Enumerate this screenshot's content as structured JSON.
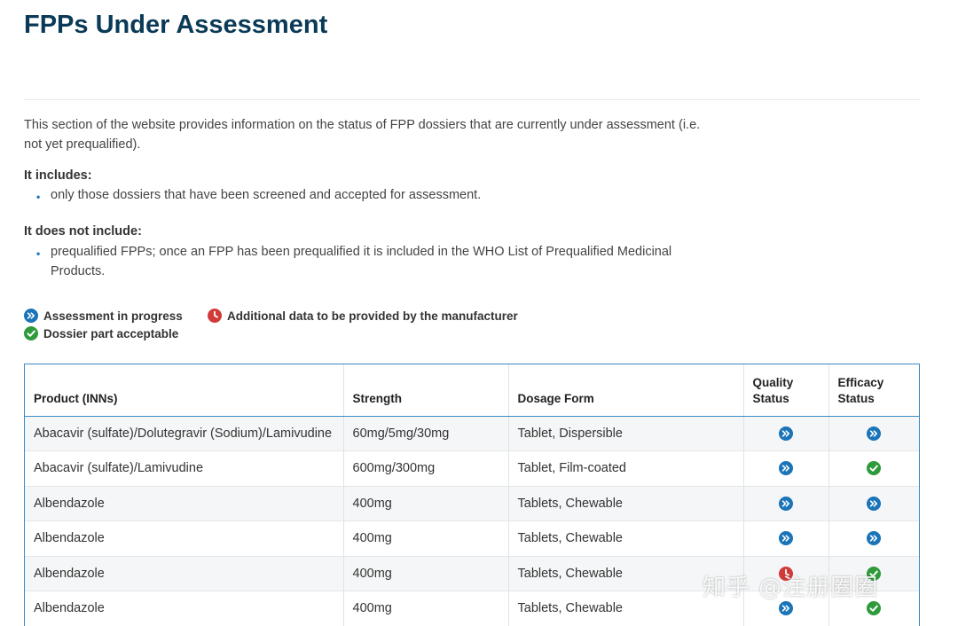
{
  "page": {
    "title": "FPPs Under Assessment",
    "intro": "This section of the website provides information on the status of FPP dossiers that are currently under assessment (i.e. not yet prequalified).",
    "includes_heading": "It includes:",
    "includes_items": [
      "only those dossiers that have been screened and accepted for assessment."
    ],
    "excludes_heading": "It does not include:",
    "excludes_items": [
      "prequalified FPPs; once an FPP has been prequalified it is included in the WHO List of Prequalified Medicinal Products."
    ]
  },
  "legend": {
    "in_progress": "Assessment in progress",
    "additional_data": "Additional data to be provided by the manufacturer",
    "acceptable": "Dossier part acceptable"
  },
  "colors": {
    "title": "#0a3a57",
    "in_progress": "#1a74b8",
    "acceptable": "#2e9a3a",
    "additional_data": "#d23a3a",
    "table_border": "#3b8bc4"
  },
  "icons": {
    "in_progress": "double-chevron-right-icon",
    "acceptable": "checkmark-icon",
    "additional_data": "clock-icon"
  },
  "table": {
    "headers": {
      "product": "Product (INNs)",
      "strength": "Strength",
      "dosage_form": "Dosage Form",
      "quality": "Quality Status",
      "efficacy": "Efficacy Status"
    },
    "rows": [
      {
        "product": "Abacavir (sulfate)/Dolutegravir (Sodium)/Lamivudine",
        "strength": "60mg/5mg/30mg",
        "dosage_form": "Tablet, Dispersible",
        "quality": "in_progress",
        "efficacy": "in_progress"
      },
      {
        "product": "Abacavir (sulfate)/Lamivudine",
        "strength": "600mg/300mg",
        "dosage_form": "Tablet, Film-coated",
        "quality": "in_progress",
        "efficacy": "acceptable"
      },
      {
        "product": "Albendazole",
        "strength": "400mg",
        "dosage_form": "Tablets, Chewable",
        "quality": "in_progress",
        "efficacy": "in_progress"
      },
      {
        "product": "Albendazole",
        "strength": "400mg",
        "dosage_form": "Tablets, Chewable",
        "quality": "in_progress",
        "efficacy": "in_progress"
      },
      {
        "product": "Albendazole",
        "strength": "400mg",
        "dosage_form": "Tablets, Chewable",
        "quality": "additional_data",
        "efficacy": "acceptable"
      },
      {
        "product": "Albendazole",
        "strength": "400mg",
        "dosage_form": "Tablets, Chewable",
        "quality": "in_progress",
        "efficacy": "acceptable"
      }
    ]
  },
  "watermark": "知乎 @注册圈圈"
}
